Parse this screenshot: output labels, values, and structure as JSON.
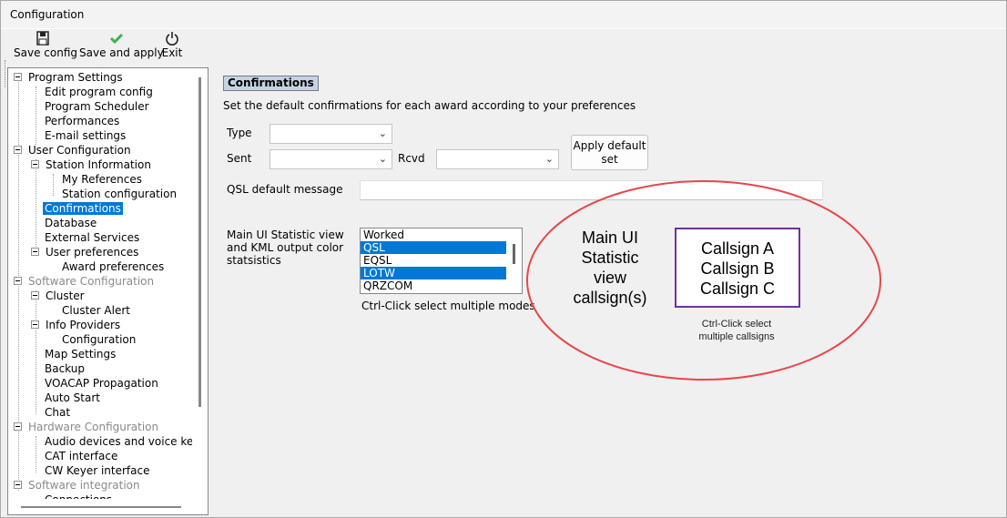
{
  "window": {
    "title": "Configuration"
  },
  "toolbar": {
    "save_config": "Save config",
    "save_apply": "Save and apply",
    "exit": "Exit",
    "icons": {
      "save": "floppy-disk-icon",
      "apply": "checkmark-icon",
      "exit": "power-icon"
    },
    "apply_color": "#3bb54a"
  },
  "tree": {
    "items": [
      {
        "label": "Program Settings"
      },
      {
        "label": "Edit program config"
      },
      {
        "label": "Program Scheduler"
      },
      {
        "label": "Performances"
      },
      {
        "label": "E-mail settings"
      },
      {
        "label": "User Configuration"
      },
      {
        "label": "Station Information"
      },
      {
        "label": "My References"
      },
      {
        "label": "Station configuration"
      },
      {
        "label": "Confirmations"
      },
      {
        "label": "Database"
      },
      {
        "label": "External Services"
      },
      {
        "label": "User preferences"
      },
      {
        "label": "Award preferences"
      },
      {
        "label": "Software Configuration"
      },
      {
        "label": "Cluster"
      },
      {
        "label": "Cluster Alert"
      },
      {
        "label": "Info Providers"
      },
      {
        "label": "Configuration"
      },
      {
        "label": "Map Settings"
      },
      {
        "label": "Backup"
      },
      {
        "label": "VOACAP Propagation"
      },
      {
        "label": "Auto Start"
      },
      {
        "label": "Chat"
      },
      {
        "label": "Hardware Configuration"
      },
      {
        "label": "Audio devices and voice keye"
      },
      {
        "label": "CAT interface"
      },
      {
        "label": "CW Keyer interface"
      },
      {
        "label": "Software integration"
      },
      {
        "label": "Connections"
      }
    ],
    "selected": "Confirmations"
  },
  "confirmations": {
    "title": "Confirmations",
    "description": "Set the default confirmations for each award according to your preferences",
    "type_label": "Type",
    "type_value": "",
    "sent_label": "Sent",
    "sent_value": "",
    "rcvd_label": "Rcvd",
    "rcvd_value": "",
    "apply_default_line1": "Apply default",
    "apply_default_line2": "set",
    "qsl_label": "QSL default message",
    "qsl_value": "",
    "stat_label_line1": "Main UI Statistic view",
    "stat_label_line2": "and KML output color",
    "stat_label_line3": "statsistics",
    "modes": [
      {
        "label": "Worked",
        "selected": false
      },
      {
        "label": "QSL",
        "selected": true
      },
      {
        "label": "EQSL",
        "selected": false
      },
      {
        "label": "LOTW",
        "selected": true
      },
      {
        "label": "QRZCOM",
        "selected": false
      }
    ],
    "modes_hint": "Ctrl-Click select multiple modes"
  },
  "annotation": {
    "main_line1": "Main UI",
    "main_line2": "Statistic",
    "main_line3": "view",
    "main_line4": "callsign(s)",
    "callsigns": [
      "Callsign A",
      "Callsign B",
      "Callsign C"
    ],
    "hint_line1": "Ctrl-Click select",
    "hint_line2": "multiple callsigns",
    "ellipse_color": "#e8474a",
    "box_color": "#7030a0"
  }
}
